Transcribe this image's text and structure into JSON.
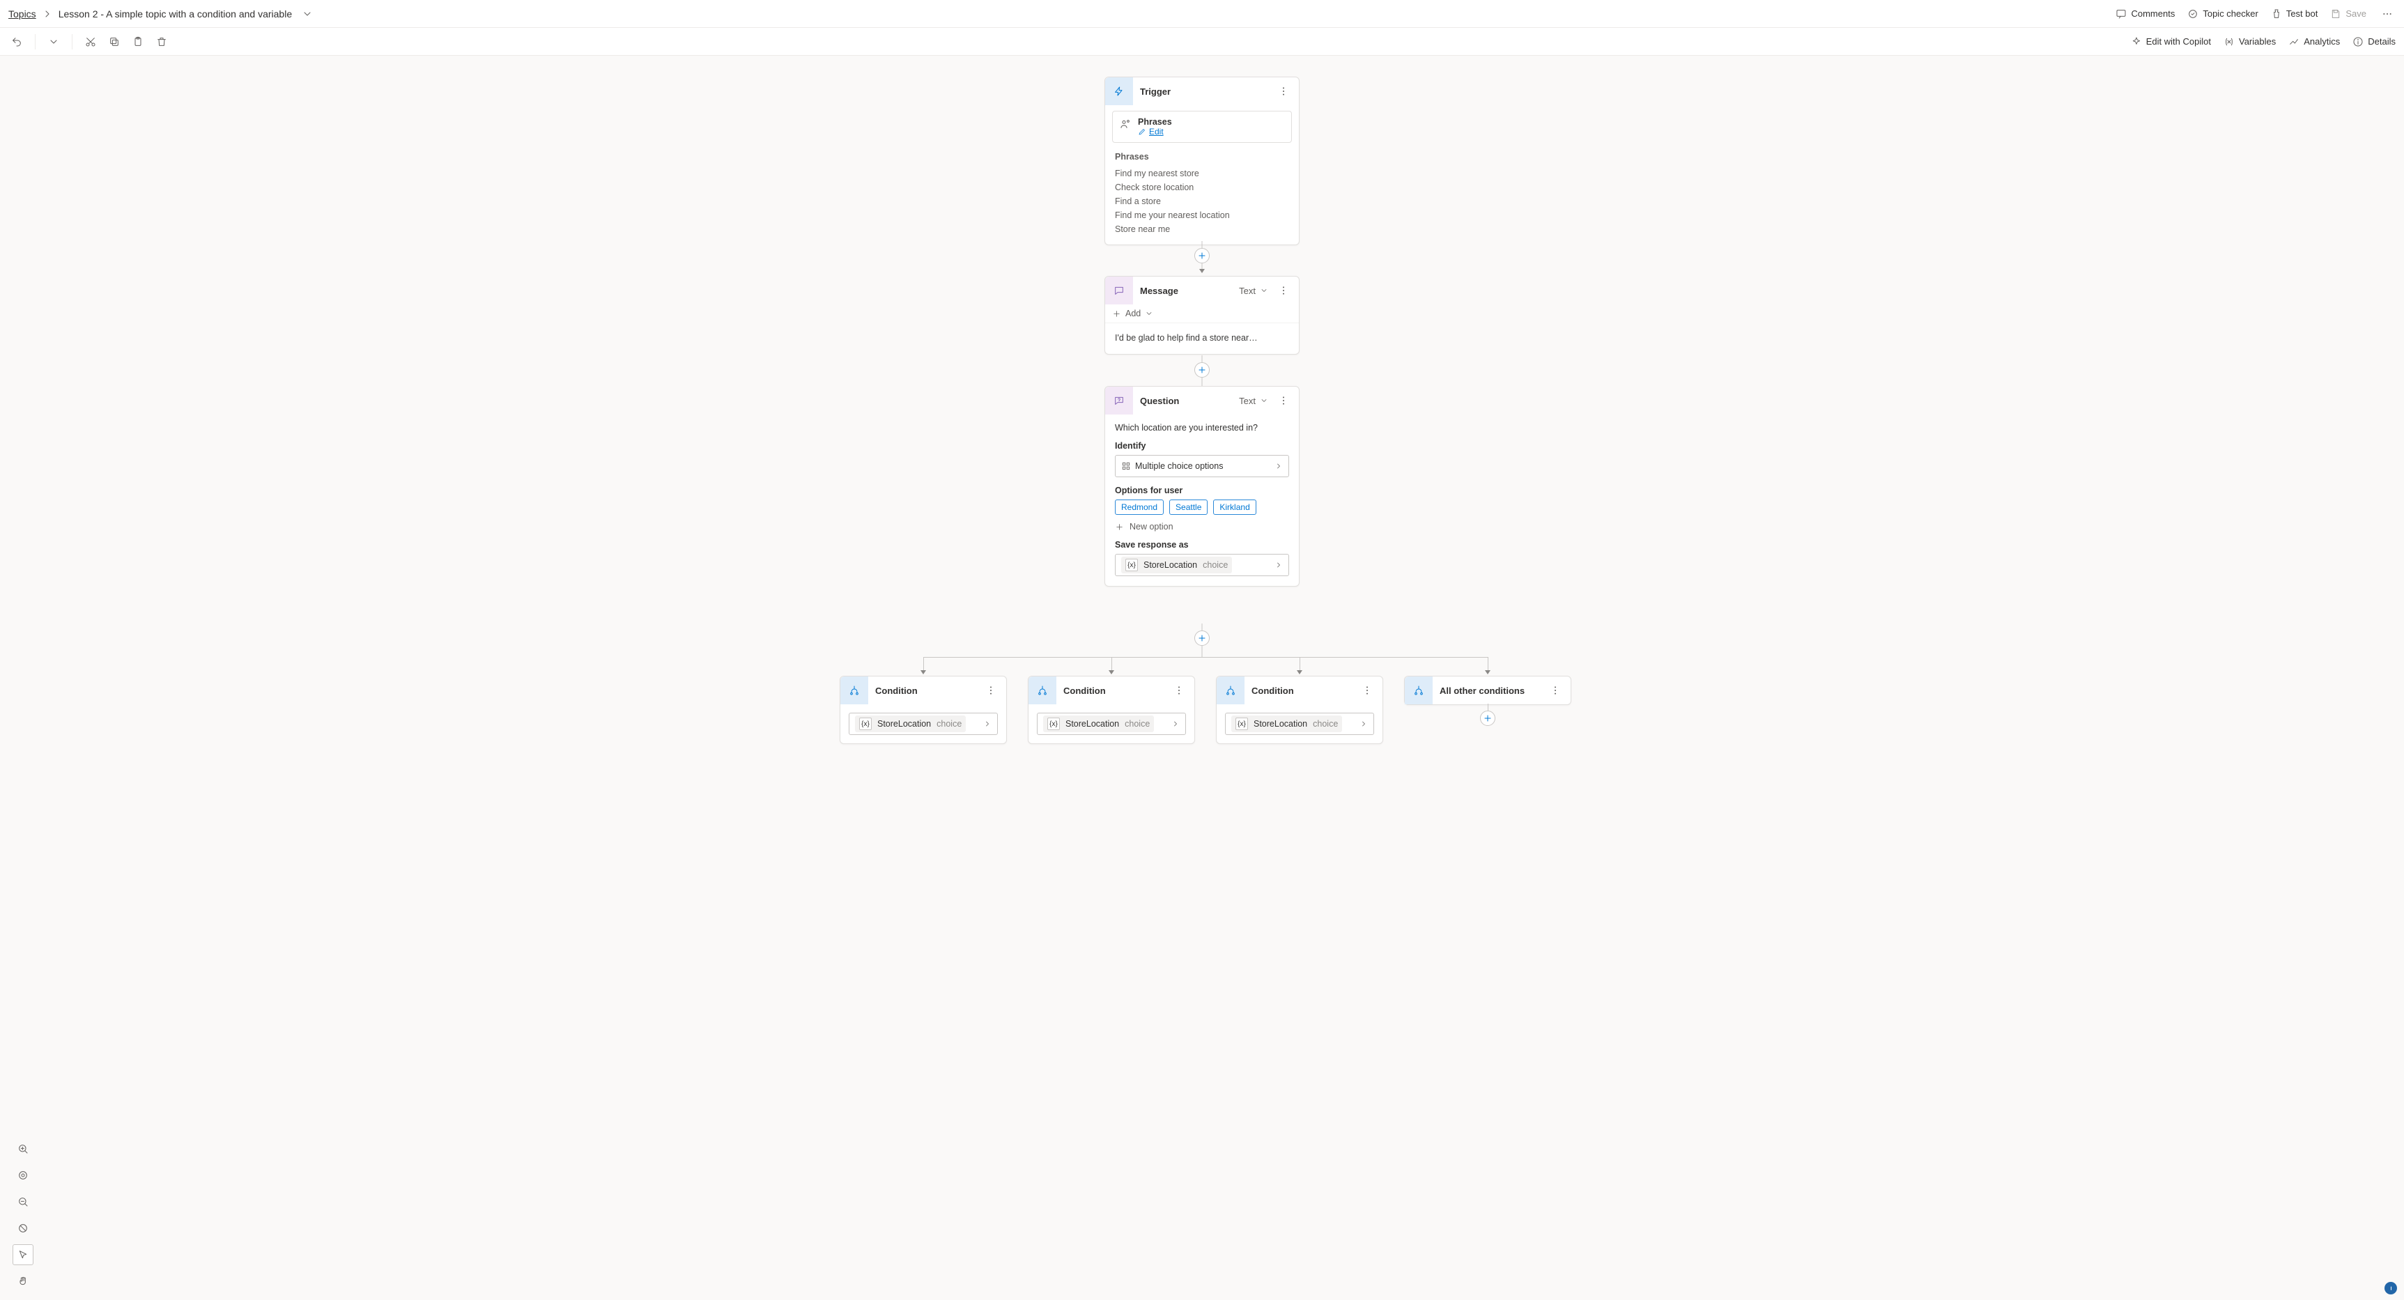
{
  "breadcrumb": {
    "root": "Topics",
    "title": "Lesson 2 - A simple topic with a condition and variable"
  },
  "top_actions": {
    "comments": "Comments",
    "checker": "Topic checker",
    "test": "Test bot",
    "save": "Save"
  },
  "edit_actions": {
    "copilot": "Edit with Copilot",
    "variables": "Variables",
    "analytics": "Analytics",
    "details": "Details"
  },
  "nodes": {
    "trigger": {
      "title": "Trigger",
      "phrases_card_title": "Phrases",
      "edit": "Edit",
      "list_heading": "Phrases",
      "phrases": [
        "Find my nearest store",
        "Check store location",
        "Find a store",
        "Find me your nearest location",
        "Store near me"
      ]
    },
    "message": {
      "title": "Message",
      "kind": "Text",
      "add": "Add",
      "text": "I'd be glad to help find a store near…"
    },
    "question": {
      "title": "Question",
      "kind": "Text",
      "text": "Which location are you interested in?",
      "identify_label": "Identify",
      "identify_value": "Multiple choice options",
      "options_label": "Options for user",
      "options": [
        "Redmond",
        "Seattle",
        "Kirkland"
      ],
      "new_option": "New option",
      "save_label": "Save response as",
      "var_name": "StoreLocation",
      "var_type": "choice"
    },
    "conditions": {
      "title": "Condition",
      "var_name": "StoreLocation",
      "var_type": "choice",
      "other_title": "All other conditions"
    }
  }
}
